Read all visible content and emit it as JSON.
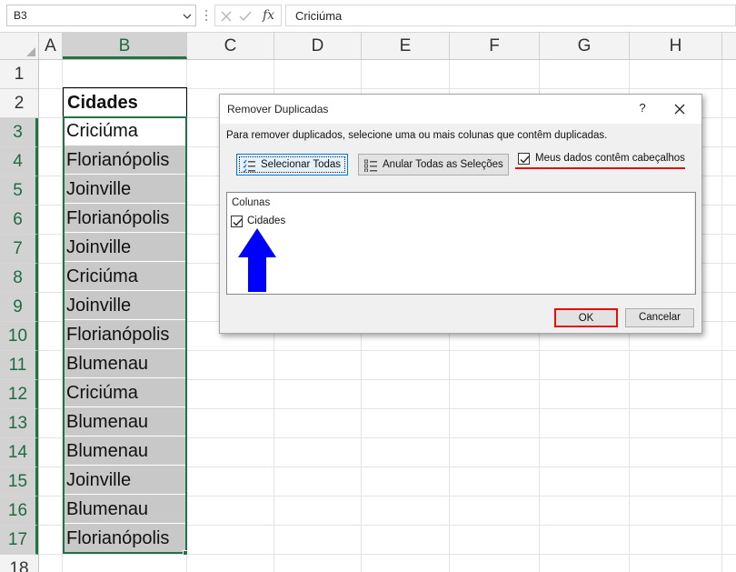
{
  "formula_bar": {
    "name_box": "B3",
    "fx_label": "fx",
    "formula_value": "Criciúma"
  },
  "columns": [
    "A",
    "B",
    "C",
    "D",
    "E",
    "F",
    "G",
    "H"
  ],
  "rows": [
    "1",
    "2",
    "3",
    "4",
    "5",
    "6",
    "7",
    "8",
    "9",
    "10",
    "11",
    "12",
    "13",
    "14",
    "15",
    "16",
    "17",
    "18"
  ],
  "sheet": {
    "header": "Cidades",
    "values": [
      "Criciúma",
      "Florianópolis",
      "Joinville",
      "Florianópolis",
      "Joinville",
      "Criciúma",
      "Joinville",
      "Florianópolis",
      "Blumenau",
      "Criciúma",
      "Blumenau",
      "Blumenau",
      "Joinville",
      "Blumenau",
      "Florianópolis"
    ]
  },
  "dialog": {
    "title": "Remover Duplicadas",
    "help": "?",
    "instruction": "Para remover duplicados, selecione uma ou mais colunas que contêm duplicadas.",
    "select_all": "Selecionar Todas",
    "unselect_all": "Anular Todas as Seleções",
    "headers_checkbox": "Meus dados contêm cabeçalhos",
    "headers_checked": true,
    "columns_header": "Colunas",
    "column_item": "Cidades",
    "column_checked": true,
    "ok": "OK",
    "cancel": "Cancelar"
  },
  "colors": {
    "excel_green": "#217346",
    "highlight_red": "#e10e0e",
    "arrow_blue": "#0000ff",
    "selected_cell_fill": "#c8c8c8"
  }
}
